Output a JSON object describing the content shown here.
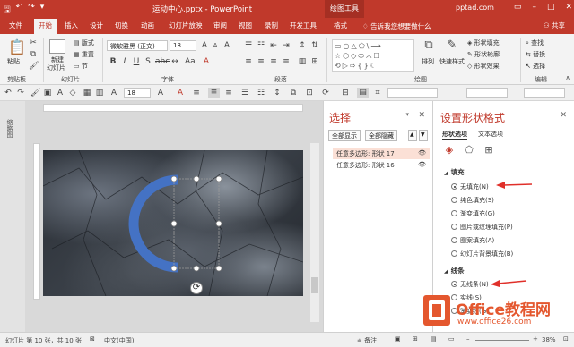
{
  "titlebar": {
    "doc_title": "运动中心.pptx - PowerPoint",
    "contextual_tab_group": "绘图工具",
    "site": "pptad.com"
  },
  "tabs": [
    {
      "label": "文件"
    },
    {
      "label": "开始"
    },
    {
      "label": "插入"
    },
    {
      "label": "设计"
    },
    {
      "label": "切换"
    },
    {
      "label": "动画"
    },
    {
      "label": "幻灯片放映"
    },
    {
      "label": "审阅"
    },
    {
      "label": "视图"
    },
    {
      "label": "录制"
    },
    {
      "label": "开发工具"
    },
    {
      "label": "格式"
    }
  ],
  "tell_me": "告诉我您想要做什么",
  "share": "共享",
  "ribbon": {
    "clipboard": {
      "paste": "粘贴",
      "group": "剪贴板"
    },
    "slides": {
      "new_slide": "新建",
      "new_slide2": "幻灯片",
      "layout": "版式",
      "reset": "重置",
      "section": "节",
      "group": "幻灯片"
    },
    "font": {
      "name": "微软雅黑 (正文)",
      "size": "18",
      "group": "字体"
    },
    "paragraph": {
      "group": "段落"
    },
    "drawing": {
      "arrange": "排列",
      "quick_styles": "快速样式",
      "fill": "形状填充",
      "outline": "形状轮廓",
      "effects": "形状效果",
      "group": "绘图"
    },
    "editing": {
      "find": "查找",
      "replace": "替换",
      "select": "选择",
      "group": "编辑"
    }
  },
  "toolbar2": {
    "font_size": "18"
  },
  "thumbstrip_label": "缩略图",
  "selection_pane": {
    "title": "选择",
    "show_all": "全部显示",
    "hide_all": "全部隐藏",
    "items": [
      {
        "label": "任意多边形: 形状 17",
        "selected": true
      },
      {
        "label": "任意多边形: 形状 16",
        "selected": false
      }
    ]
  },
  "format_pane": {
    "title": "设置形状格式",
    "tab_shape": "形状选项",
    "tab_text": "文本选项",
    "fill_header": "填充",
    "fill_options": [
      {
        "label": "无填充(N)",
        "checked": true
      },
      {
        "label": "纯色填充(S)",
        "checked": false
      },
      {
        "label": "渐变填充(G)",
        "checked": false
      },
      {
        "label": "图片或纹理填充(P)",
        "checked": false
      },
      {
        "label": "图案填充(A)",
        "checked": false
      },
      {
        "label": "幻灯片背景填充(B)",
        "checked": false
      }
    ],
    "line_header": "线条",
    "line_options": [
      {
        "label": "无线条(N)",
        "checked": true
      },
      {
        "label": "实线(S)",
        "checked": false
      },
      {
        "label": "渐变线(G)",
        "checked": false
      }
    ]
  },
  "statusbar": {
    "slide_info": "幻灯片 第 10 张，共 10 张",
    "language": "中文(中国)",
    "notes": "备注",
    "zoom": "38%"
  },
  "watermark": {
    "brand": "Office教程网",
    "url": "www.office26.com"
  },
  "colors": {
    "accent": "#c0392b",
    "arc": "#4472c4",
    "arrow": "#e0302a"
  }
}
